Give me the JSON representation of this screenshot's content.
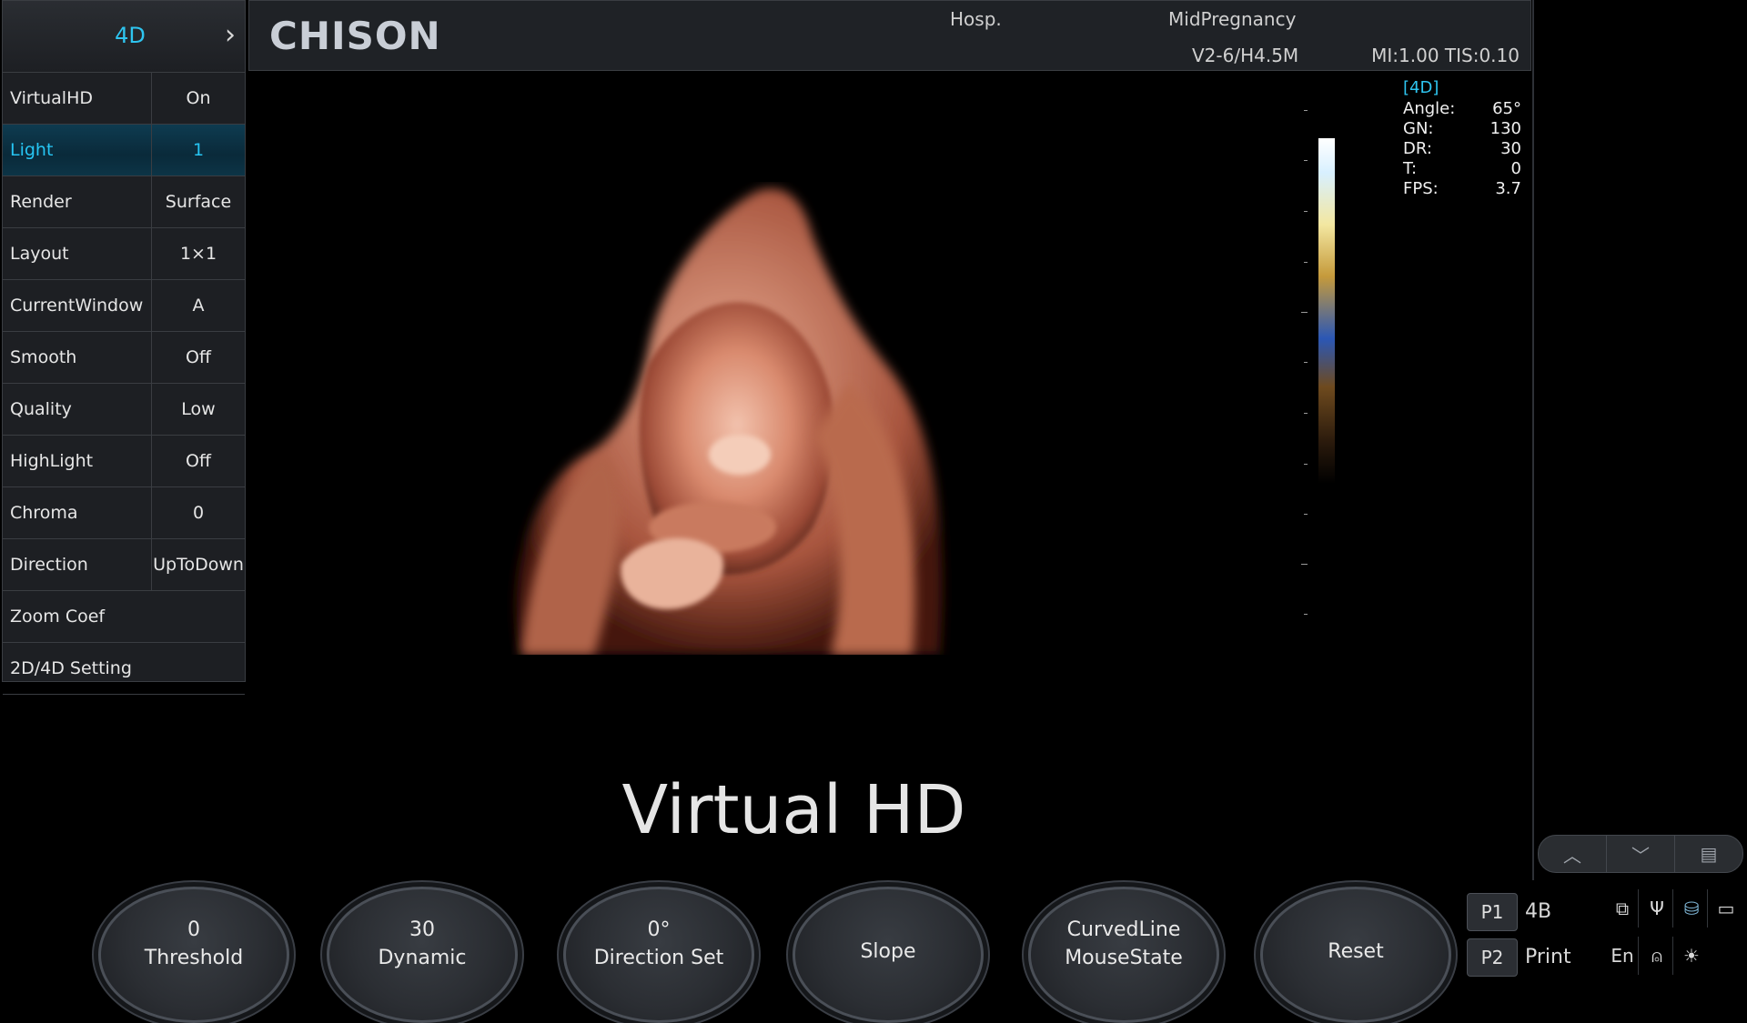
{
  "menu": {
    "title": "4D",
    "next_icon": "chevron-right-icon",
    "rows": [
      {
        "label": "VirtualHD",
        "value": "On"
      },
      {
        "label": "Light",
        "value": "1",
        "active": true
      },
      {
        "label": "Render",
        "value": "Surface"
      },
      {
        "label": "Layout",
        "value": "1×1"
      },
      {
        "label": "CurrentWindow",
        "value": "A"
      },
      {
        "label": "Smooth",
        "value": "Off"
      },
      {
        "label": "Quality",
        "value": "Low"
      },
      {
        "label": "HighLight",
        "value": "Off"
      },
      {
        "label": "Chroma",
        "value": "0"
      },
      {
        "label": "Direction",
        "value": "UpToDown"
      },
      {
        "label": "Zoom Coef"
      },
      {
        "label": "2D/4D Setting"
      }
    ]
  },
  "header": {
    "brand": "CHISON",
    "hospital": "Hosp.",
    "exam_preset": "MidPregnancy",
    "probe": "V2-6/H4.5M",
    "mi_tis": "MI:1.00  TIS:0.10"
  },
  "readout": {
    "mode": "[4D]",
    "rows": [
      {
        "label": "Angle:",
        "value": "65°"
      },
      {
        "label": "GN:",
        "value": "130"
      },
      {
        "label": "DR:",
        "value": "30"
      },
      {
        "label": "T:",
        "value": "0"
      },
      {
        "label": "FPS:",
        "value": "3.7"
      }
    ]
  },
  "overlay_text": "Virtual HD",
  "knobs": [
    {
      "value": "0",
      "name": "Threshold"
    },
    {
      "value": "30",
      "name": "Dynamic"
    },
    {
      "value": "0°",
      "name": "Direction Set"
    },
    {
      "name": "Slope"
    },
    {
      "line1": "CurvedLine",
      "line2": "MouseState"
    },
    {
      "name": "Reset"
    }
  ],
  "presets": [
    {
      "key": "P1",
      "label": "4B"
    },
    {
      "key": "P2",
      "label": "Print"
    }
  ],
  "status": {
    "language": "En",
    "icons": [
      "network-icon",
      "usb-icon",
      "storage-icon",
      "display-icon",
      "mouse-icon",
      "brightness-icon"
    ]
  },
  "scroll_controls": [
    "chevron-up-icon",
    "chevron-down-icon",
    "list-icon"
  ],
  "colors": {
    "accent": "#2ec5f0",
    "panel": "#1d1f23",
    "active_row": "#0e3b50"
  }
}
